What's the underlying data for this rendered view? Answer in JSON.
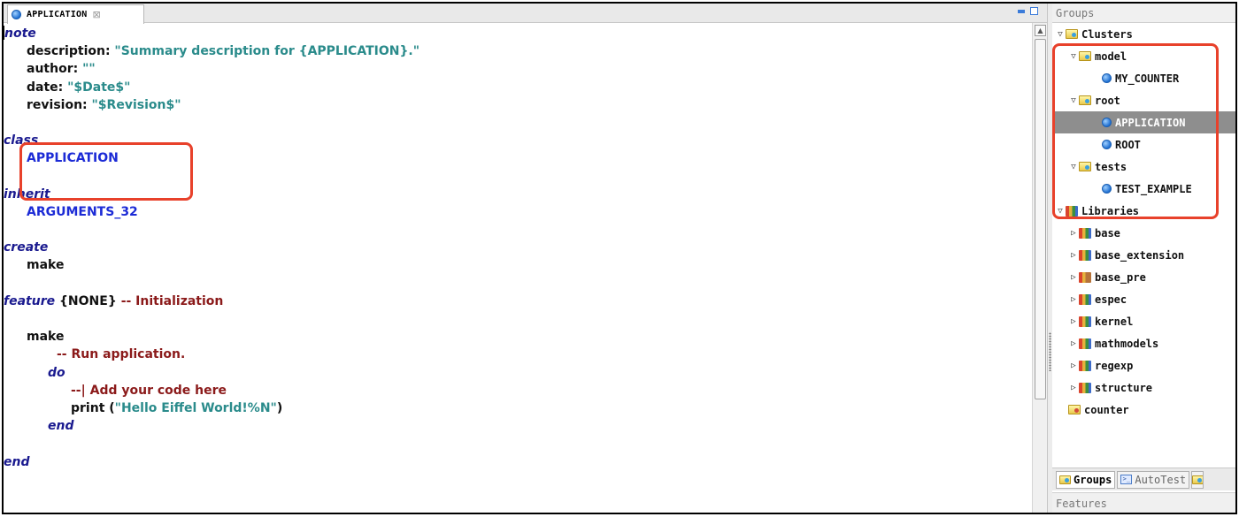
{
  "editor": {
    "tab_label": "APPLICATION",
    "code": {
      "note_kw": "note",
      "desc_key": "description: ",
      "desc_val": "\"Summary description for {APPLICATION}.\"",
      "author_key": "author: ",
      "author_val": "\"\"",
      "date_key": "date: ",
      "date_val": "\"$Date$\"",
      "revision_key": "revision: ",
      "revision_val": "\"$Revision$\"",
      "class_kw": "class",
      "class_name": "APPLICATION",
      "inherit_kw": "inherit",
      "parent_name": "ARGUMENTS_32",
      "create_kw": "create",
      "creation_proc": "make",
      "feature_kw": "feature",
      "feature_export": " {NONE} ",
      "feature_comment": "-- Initialization",
      "make_name": "make",
      "make_comment": "-- Run application.",
      "do_kw": "do",
      "todo_comment": "--| Add your code here",
      "print_call": "print (",
      "print_string": "\"Hello Eiffel World!%N\"",
      "print_close": ")",
      "end_kw": "end",
      "final_end": "end"
    }
  },
  "groups_panel": {
    "header": "Groups",
    "tree": [
      {
        "label": "Clusters",
        "icon": "cluster-folder-icon",
        "expanded": true
      },
      {
        "label": "model",
        "icon": "cluster-folder-icon",
        "expanded": true
      },
      {
        "label": "MY_COUNTER",
        "icon": "class-icon"
      },
      {
        "label": "root",
        "icon": "cluster-folder-icon",
        "expanded": true
      },
      {
        "label": "APPLICATION",
        "icon": "class-icon",
        "selected": true
      },
      {
        "label": "ROOT",
        "icon": "class-icon"
      },
      {
        "label": "tests",
        "icon": "cluster-folder-icon",
        "expanded": true
      },
      {
        "label": "TEST_EXAMPLE",
        "icon": "class-icon"
      },
      {
        "label": "Libraries",
        "icon": "library-icon",
        "expanded": true
      },
      {
        "label": "base",
        "icon": "library-icon"
      },
      {
        "label": "base_extension",
        "icon": "library-icon"
      },
      {
        "label": "base_pre",
        "icon": "library-precompiled-icon"
      },
      {
        "label": "espec",
        "icon": "library-icon"
      },
      {
        "label": "kernel",
        "icon": "library-icon"
      },
      {
        "label": "mathmodels",
        "icon": "library-icon"
      },
      {
        "label": "regexp",
        "icon": "library-icon"
      },
      {
        "label": "structure",
        "icon": "library-icon"
      },
      {
        "label": "counter",
        "icon": "target-folder-icon"
      }
    ],
    "bottom_tabs": {
      "groups": "Groups",
      "autotest": "AutoTest"
    },
    "features_header": "Features"
  },
  "colors": {
    "keyword": "#1a1a8f",
    "string": "#2a8b8b",
    "comment": "#8b1a1a",
    "class_name": "#1c2bd6",
    "highlight": "#e8412b",
    "selection": "#8e8e8e"
  }
}
